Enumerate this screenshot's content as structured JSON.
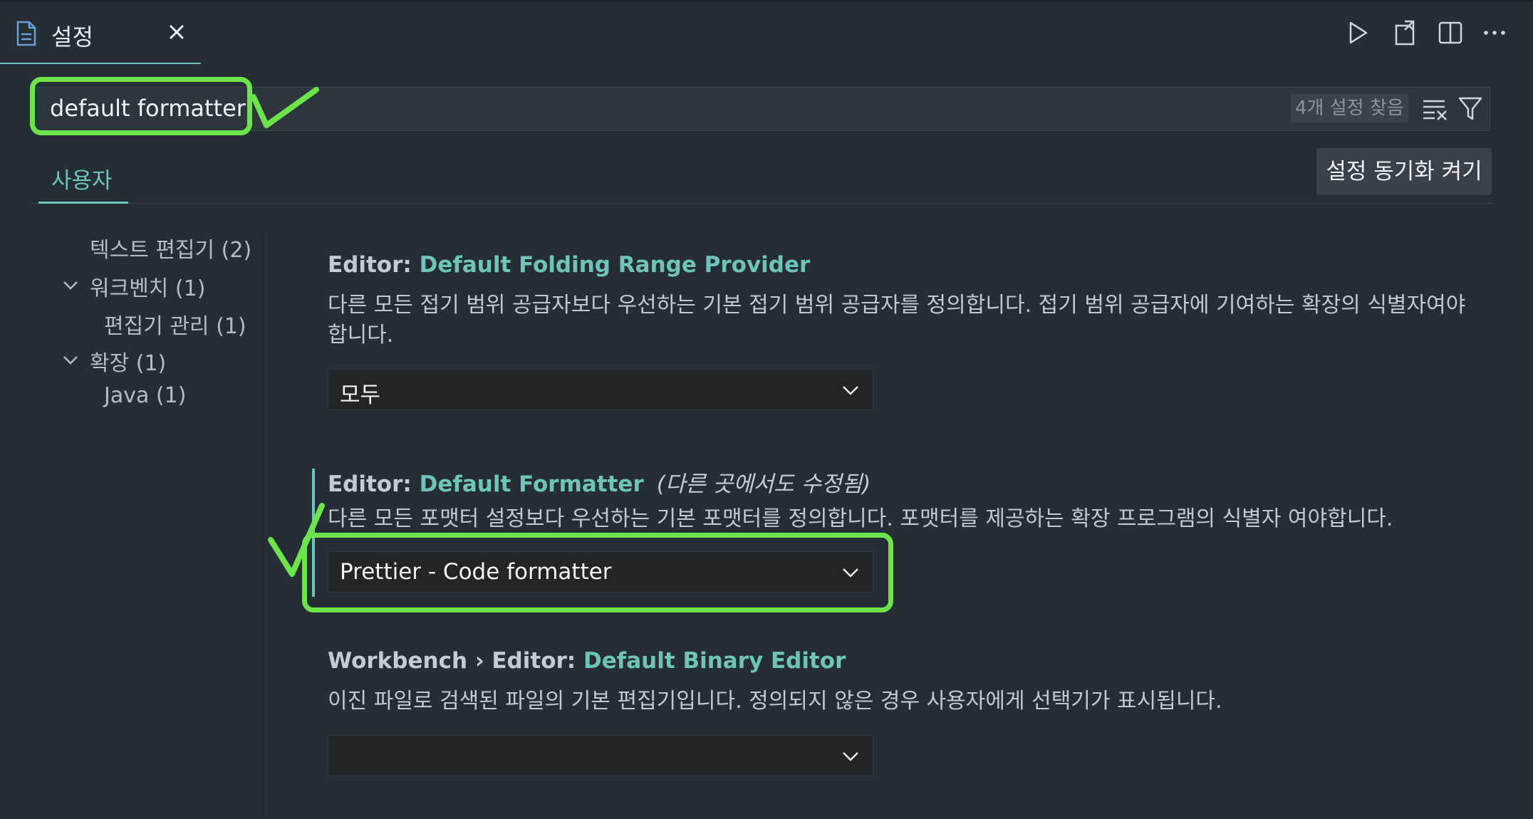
{
  "tab": {
    "label": "설정",
    "icon": "file-icon",
    "close_icon": "close-icon"
  },
  "toolbar": {
    "icons": [
      "run-icon",
      "open-json-icon",
      "split-editor-icon",
      "more-actions-icon"
    ]
  },
  "search": {
    "value": "default formatter",
    "result_count": "4개 설정 찾음",
    "clear_icon": "clear-filter-icon",
    "filter_icon": "filter-icon"
  },
  "scope": {
    "user_tab": "사용자",
    "sync_button": "설정 동기화 켜기"
  },
  "toc": {
    "items": [
      {
        "label": "텍스트 편집기 (2)",
        "level": 1,
        "expandable": false
      },
      {
        "label": "워크벤치 (1)",
        "level": 1,
        "expandable": true
      },
      {
        "label": "편집기 관리 (1)",
        "level": 2,
        "expandable": false
      },
      {
        "label": "확장 (1)",
        "level": 1,
        "expandable": true
      },
      {
        "label": "Java (1)",
        "level": 2,
        "expandable": false
      }
    ]
  },
  "settings": [
    {
      "category": "Editor: ",
      "key": "Default Folding Range Provider",
      "modified": "",
      "description": "다른 모든 접기 범위 공급자보다 우선하는 기본 접기 범위 공급자를 정의합니다. 접기 범위 공급자에 기여하는 확장의 식별자여야 합니다.",
      "value": "모두"
    },
    {
      "category": "Editor: ",
      "key": "Default Formatter",
      "modified": "(다른 곳에서도 수정됨)",
      "description": "다른 모든 포맷터 설정보다 우선하는 기본 포맷터를 정의합니다. 포맷터를 제공하는 확장 프로그램의 식별자 여야합니다.",
      "value": "Prettier - Code formatter"
    },
    {
      "category": "Workbench › Editor: ",
      "key": "Default Binary Editor",
      "modified": "",
      "description": "이진 파일로 검색된 파일의 기본 편집기입니다. 정의되지 않은 경우 사용자에게 선택기가 표시됩니다.",
      "value": ""
    }
  ],
  "colors": {
    "accent": "#6ec4b8",
    "annotation": "#6de34c",
    "background": "#262e35"
  }
}
